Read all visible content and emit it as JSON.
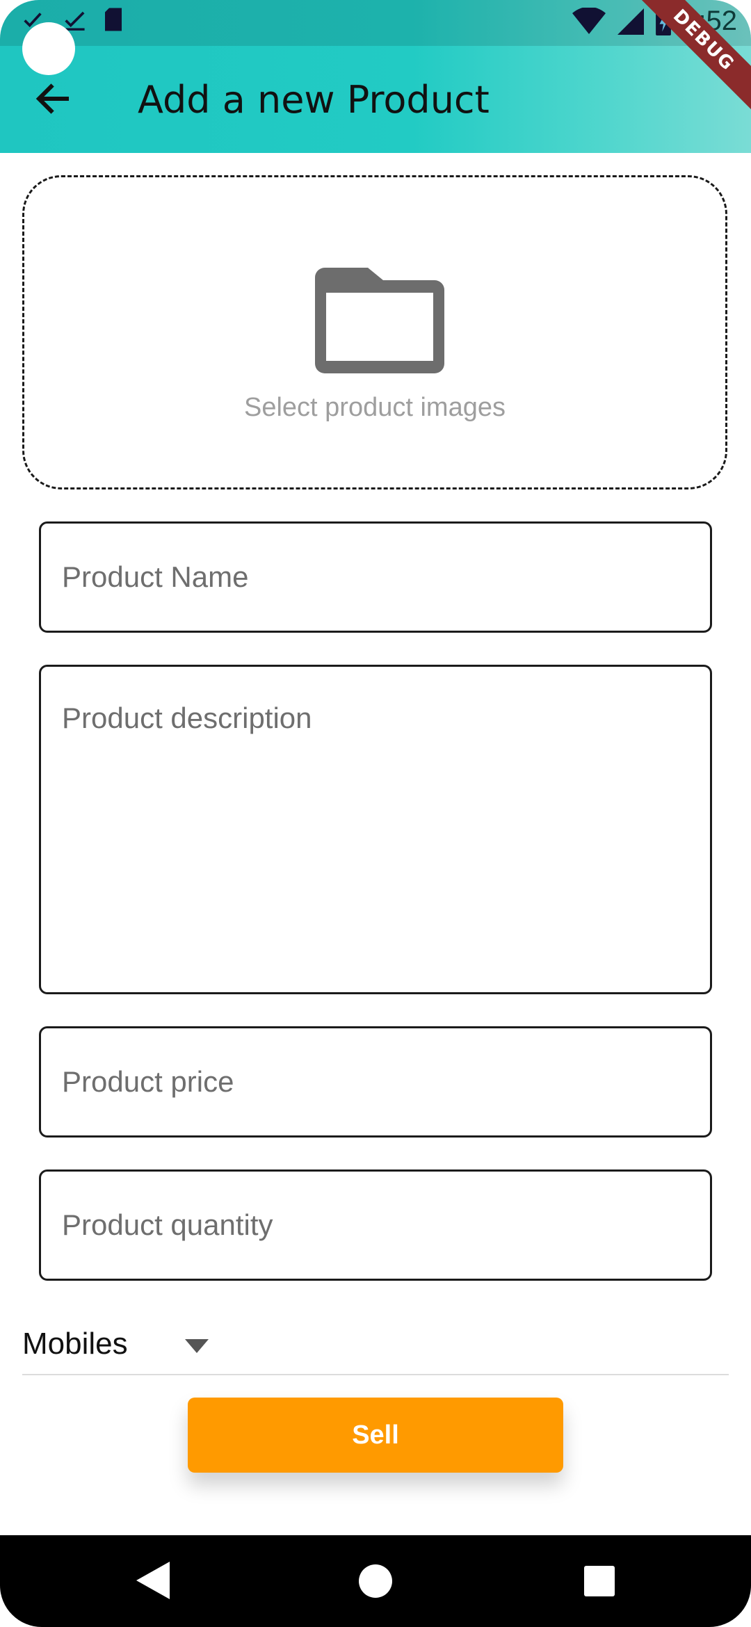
{
  "status_bar": {
    "time": "5:52",
    "icons": [
      "check-icon",
      "check-icon",
      "sd-card-icon",
      "wifi-icon",
      "signal-icon",
      "battery-charging-icon"
    ]
  },
  "debug_banner": "DEBUG",
  "app_bar": {
    "back_icon": "arrow-back-icon",
    "title": "Add a new Product",
    "background": "#22cbc4"
  },
  "image_picker": {
    "icon": "folder-icon",
    "label": "Select product images"
  },
  "form": {
    "name": {
      "placeholder": "Product Name",
      "value": ""
    },
    "description": {
      "placeholder": "Product description",
      "value": ""
    },
    "price": {
      "placeholder": "Product price",
      "value": ""
    },
    "quantity": {
      "placeholder": "Product quantity",
      "value": ""
    }
  },
  "category_dropdown": {
    "selected": "Mobiles",
    "icon": "arrow-drop-down-icon"
  },
  "sell_button": {
    "label": "Sell",
    "color": "#ff9a00"
  },
  "nav_bar": {
    "icons": [
      "nav-back-icon",
      "nav-home-icon",
      "nav-recents-icon"
    ]
  }
}
